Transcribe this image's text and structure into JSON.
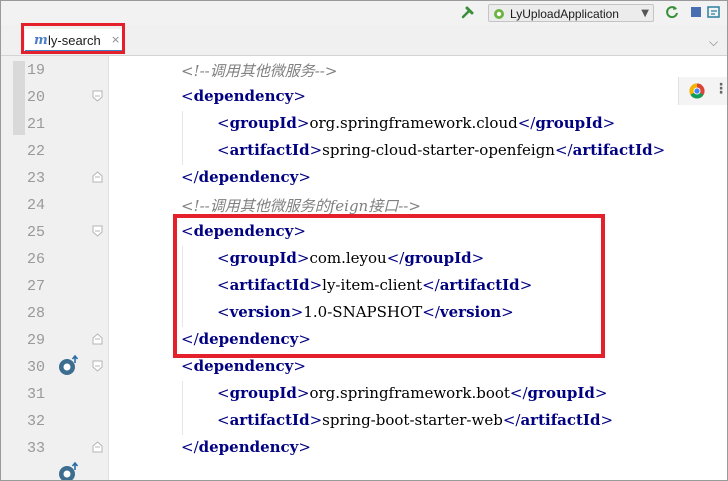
{
  "toolbar": {
    "run_configuration": "LyUploadApplication"
  },
  "tab": {
    "icon_letter": "m",
    "label": "ly-search",
    "close_glyph": "×"
  },
  "colors": {
    "highlight_box": "#e3202b",
    "tag": "#000080",
    "comment": "#808080",
    "line_number": "#999999"
  },
  "icons": {
    "build": "hammer-icon",
    "run_config": "spring-boot-icon",
    "gutter_marker": "implemented-override-icon",
    "browser": "chrome-icon"
  },
  "lines": [
    {
      "num": "19",
      "indent": 1,
      "comment": "<!--调用其他微服务-->"
    },
    {
      "num": "20",
      "indent": 1,
      "open": "dependency"
    },
    {
      "num": "21",
      "indent": 2,
      "tag": "groupId",
      "value": "org.springframework.cloud"
    },
    {
      "num": "22",
      "indent": 2,
      "tag": "artifactId",
      "value": "spring-cloud-starter-openfeign"
    },
    {
      "num": "23",
      "indent": 1,
      "close": "dependency"
    },
    {
      "num": "24",
      "indent": 1,
      "comment": "<!--调用其他微服务的feign接口-->"
    },
    {
      "num": "25",
      "indent": 1,
      "open": "dependency"
    },
    {
      "num": "26",
      "indent": 2,
      "tag": "groupId",
      "value": "com.leyou"
    },
    {
      "num": "27",
      "indent": 2,
      "tag": "artifactId",
      "value": "ly-item-client"
    },
    {
      "num": "28",
      "indent": 2,
      "tag": "version",
      "value": "1.0-SNAPSHOT"
    },
    {
      "num": "29",
      "indent": 1,
      "close": "dependency"
    },
    {
      "num": "30",
      "indent": 1,
      "open": "dependency"
    },
    {
      "num": "31",
      "indent": 2,
      "tag": "groupId",
      "value": "org.springframework.boot"
    },
    {
      "num": "32",
      "indent": 2,
      "tag": "artifactId",
      "value": "spring-boot-starter-web"
    },
    {
      "num": "33",
      "indent": 1,
      "close": "dependency"
    }
  ]
}
